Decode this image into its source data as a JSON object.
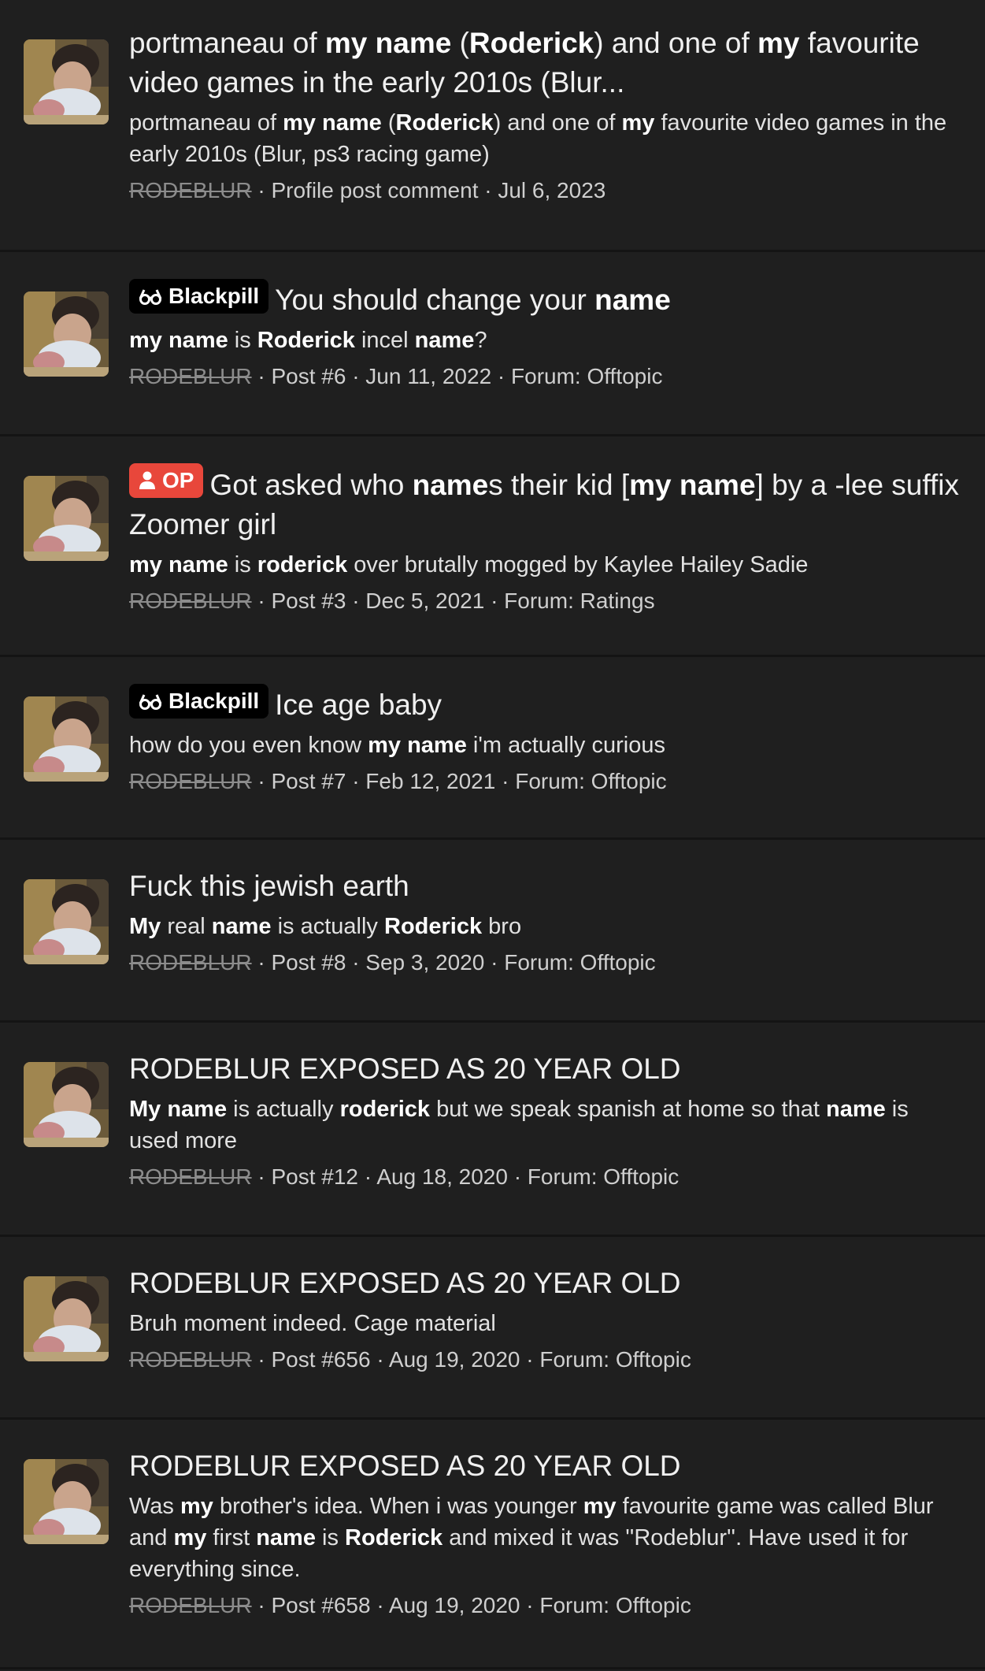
{
  "colors": {
    "background": "#1f1f1f",
    "op_badge": "#e8473b",
    "blackpill_badge": "#000000",
    "author_strike": "#8c8c8c"
  },
  "results": [
    {
      "title_parts": [
        [
          "portmaneau of ",
          0
        ],
        [
          "my name",
          1
        ],
        [
          " (",
          0
        ],
        [
          "Roderick",
          1
        ],
        [
          ") and one of ",
          0
        ],
        [
          "my",
          1
        ],
        [
          " favourite",
          0
        ]
      ],
      "title_line2": "video games in the early 2010s (Blur...",
      "badge": null,
      "snippet_parts": [
        [
          "portmaneau of ",
          0
        ],
        [
          "my name",
          1
        ],
        [
          " (",
          0
        ],
        [
          "Roderick",
          1
        ],
        [
          ") and one of ",
          0
        ],
        [
          "my",
          1
        ],
        [
          " favourite video games in the",
          0
        ]
      ],
      "snippet_line2": "early 2010s (Blur, ps3 racing game)",
      "author": "RODEBLUR",
      "meta": " · Profile post comment · Jul 6, 2023"
    },
    {
      "badge": {
        "type": "blackpill",
        "label": "Blackpill",
        "icon": "glasses-icon"
      },
      "title_parts": [
        [
          "You should change your ",
          0
        ],
        [
          "name",
          1
        ]
      ],
      "snippet_parts": [
        [
          "my name",
          1
        ],
        [
          " is ",
          0
        ],
        [
          "Roderick",
          1
        ],
        [
          " incel ",
          0
        ],
        [
          "name",
          1
        ],
        [
          "?",
          0
        ]
      ],
      "author": "RODEBLUR",
      "meta": " · Post #6 · Jun 11, 2022 · Forum: Offtopic"
    },
    {
      "badge": {
        "type": "op",
        "label": "OP",
        "icon": "user-icon"
      },
      "title_parts": [
        [
          "Got asked who ",
          0
        ],
        [
          "name",
          1
        ],
        [
          "s their kid [",
          0
        ],
        [
          "my name",
          1
        ],
        [
          "] by a -lee suffix",
          0
        ]
      ],
      "title_line2": "Zoomer girl",
      "snippet_parts": [
        [
          "my name",
          1
        ],
        [
          " is ",
          0
        ],
        [
          "roderick",
          1
        ],
        [
          " over brutally mogged by Kaylee Hailey Sadie",
          0
        ]
      ],
      "author": "RODEBLUR",
      "meta": " · Post #3 · Dec 5, 2021 · Forum: Ratings"
    },
    {
      "badge": {
        "type": "blackpill",
        "label": "Blackpill",
        "icon": "glasses-icon"
      },
      "title_parts": [
        [
          "Ice age baby",
          0
        ]
      ],
      "snippet_parts": [
        [
          "how do you even know ",
          0
        ],
        [
          "my name",
          1
        ],
        [
          " i'm actually curious",
          0
        ]
      ],
      "author": "RODEBLUR",
      "meta": " · Post #7 · Feb 12, 2021 · Forum: Offtopic"
    },
    {
      "badge": null,
      "title_parts": [
        [
          "Fuck this jewish earth",
          0
        ]
      ],
      "snippet_parts": [
        [
          "My",
          1
        ],
        [
          " real ",
          0
        ],
        [
          "name",
          1
        ],
        [
          " is actually ",
          0
        ],
        [
          "Roderick",
          1
        ],
        [
          " bro",
          0
        ]
      ],
      "author": "RODEBLUR",
      "meta": " · Post #8 · Sep 3, 2020 · Forum: Offtopic"
    },
    {
      "badge": null,
      "title_parts": [
        [
          "RODEBLUR EXPOSED AS 20 YEAR OLD",
          0
        ]
      ],
      "snippet_parts": [
        [
          "My name",
          1
        ],
        [
          " is actually ",
          0
        ],
        [
          "roderick",
          1
        ],
        [
          " but we speak spanish at home so that ",
          0
        ],
        [
          "name",
          1
        ],
        [
          " is",
          0
        ]
      ],
      "snippet_line2": "used more",
      "author": "RODEBLUR",
      "meta": " · Post #12 · Aug 18, 2020 · Forum: Offtopic"
    },
    {
      "badge": null,
      "title_parts": [
        [
          "RODEBLUR EXPOSED AS 20 YEAR OLD",
          0
        ]
      ],
      "snippet_parts": [
        [
          "Bruh moment indeed. Cage material",
          0
        ]
      ],
      "author": "RODEBLUR",
      "meta": " · Post #656 · Aug 19, 2020 · Forum: Offtopic"
    },
    {
      "badge": null,
      "title_parts": [
        [
          "RODEBLUR EXPOSED AS 20 YEAR OLD",
          0
        ]
      ],
      "snippet_parts": [
        [
          "Was ",
          0
        ],
        [
          "my",
          1
        ],
        [
          " brother's idea. When i was younger ",
          0
        ],
        [
          "my",
          1
        ],
        [
          " favourite game was called Blur",
          0
        ]
      ],
      "snippet_more": [
        [
          [
            "and ",
            0
          ],
          [
            "my",
            1
          ],
          [
            " first ",
            0
          ],
          [
            "name",
            1
          ],
          [
            " is ",
            0
          ],
          [
            "Roderick",
            1
          ],
          [
            " and mixed it was ''Rodeblur''. Have used it for",
            0
          ]
        ],
        [
          [
            "everything since.",
            0
          ]
        ]
      ],
      "author": "RODEBLUR",
      "meta": " · Post #658 · Aug 19, 2020 · Forum: Offtopic"
    }
  ]
}
